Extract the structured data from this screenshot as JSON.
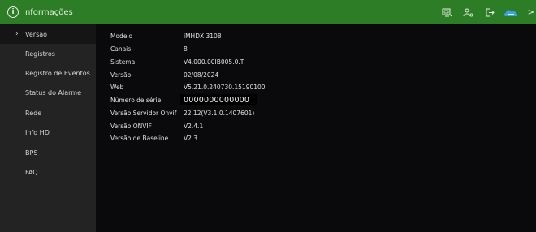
{
  "header": {
    "title": "Informações",
    "icons": [
      "monitor-icon",
      "user-icon",
      "logout-icon",
      "cloud-icon",
      "more-icon"
    ],
    "more_glyph": ">"
  },
  "sidebar": {
    "items": [
      {
        "label": "Versão",
        "active": true
      },
      {
        "label": "Registros"
      },
      {
        "label": "Registro de Eventos"
      },
      {
        "label": "Status do Alarme"
      },
      {
        "label": "Rede"
      },
      {
        "label": "Info HD"
      },
      {
        "label": "BPS"
      },
      {
        "label": "FAQ"
      }
    ]
  },
  "info": {
    "rows": [
      {
        "key": "Modelo",
        "value": "iMHDX 3108"
      },
      {
        "key": "Canais",
        "value": "8"
      },
      {
        "key": "Sistema",
        "value": "V4.000.00IB005.0.T"
      },
      {
        "key": "Versão",
        "value": "02/08/2024"
      },
      {
        "key": "Web",
        "value": "V5.21.0.240730.15190100"
      },
      {
        "key": "Número de série",
        "value": "0000000000000"
      },
      {
        "key": "Versão Servidor Onvif",
        "value": "22.12(V3.1.0.1407601)"
      },
      {
        "key": "Versão ONVIF",
        "value": "V2.4.1"
      },
      {
        "key": "Versão de Baseline",
        "value": "V2.3"
      }
    ]
  },
  "colors": {
    "header_green": "#2d7d27",
    "sidebar_bg": "#232323",
    "content_bg": "#0a0a0c",
    "cloud_blue": "#3aa3e8"
  }
}
